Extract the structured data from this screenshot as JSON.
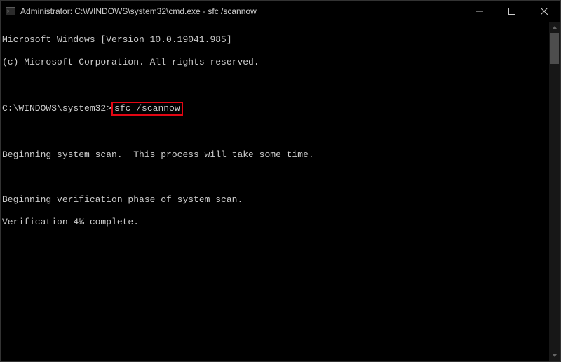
{
  "titlebar": {
    "title": "Administrator: C:\\WINDOWS\\system32\\cmd.exe - sfc  /scannow"
  },
  "console": {
    "version_line": "Microsoft Windows [Version 10.0.19041.985]",
    "copyright_line": "(c) Microsoft Corporation. All rights reserved.",
    "prompt": "C:\\WINDOWS\\system32>",
    "command": "sfc /scannow",
    "scan_begin_line": "Beginning system scan.  This process will take some time.",
    "verify_begin_line": "Beginning verification phase of system scan.",
    "verify_progress_line": "Verification 4% complete."
  }
}
